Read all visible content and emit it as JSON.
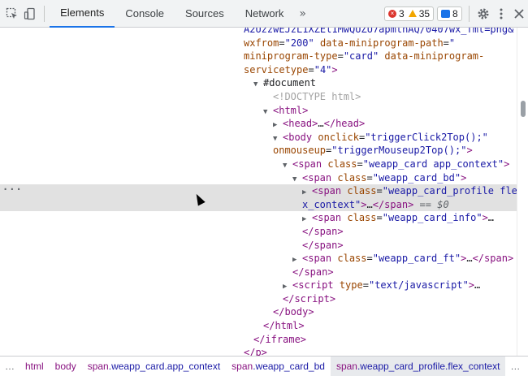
{
  "toolbar": {
    "tabs": [
      "Elements",
      "Console",
      "Sources",
      "Network"
    ],
    "more": "»",
    "errors": "3",
    "warnings": "35",
    "messages": "8"
  },
  "tree": {
    "line0": "A2UzzwEJzL1XZEl1MwQUZU7apmthAQ/0407wx_fmt=png&",
    "line1_attr1": "wxfrom",
    "line1_val1": "\"200\"",
    "line1_attr2": "data-miniprogram-path",
    "line1_attr2b": "data-",
    "line2_attr": "miniprogram-type",
    "line2_val": "\"card\"",
    "line2_attr2": "data-miniprogram-",
    "line3_attr": "servicetype",
    "line3_val": "\"4\"",
    "document": "#document",
    "doctype": "<!DOCTYPE html>",
    "html_open": "<html>",
    "head": "head",
    "body": "body",
    "onclick": "onclick",
    "onclick_val": "\"triggerClick2Top();\"",
    "onmouseup": "onmouseup",
    "onmouseup_val": "\"triggerMouseup2Top();\"",
    "span": "span",
    "class": "class",
    "cls_card": "\"weapp_card app_context\"",
    "cls_bd": "\"weapp_card_bd\"",
    "cls_profile_a": "\"weapp_card_profile fle",
    "cls_profile_b": "x_context\"",
    "eq0": "== $0",
    "cls_info": "\"weapp_card_info\"",
    "cls_ft": "\"weapp_card_ft\"",
    "script": "script",
    "type": "type",
    "type_val": "\"text/javascript\"",
    "iframe_close": "</iframe>",
    "p_close": "</p>"
  },
  "breadcrumbs": [
    {
      "tag": "html",
      "cls": ""
    },
    {
      "tag": "body",
      "cls": ""
    },
    {
      "tag": "span",
      "cls": ".weapp_card.app_context"
    },
    {
      "tag": "span",
      "cls": ".weapp_card_bd"
    },
    {
      "tag": "span",
      "cls": ".weapp_card_profile.flex_context"
    }
  ],
  "crumb_more": "…"
}
